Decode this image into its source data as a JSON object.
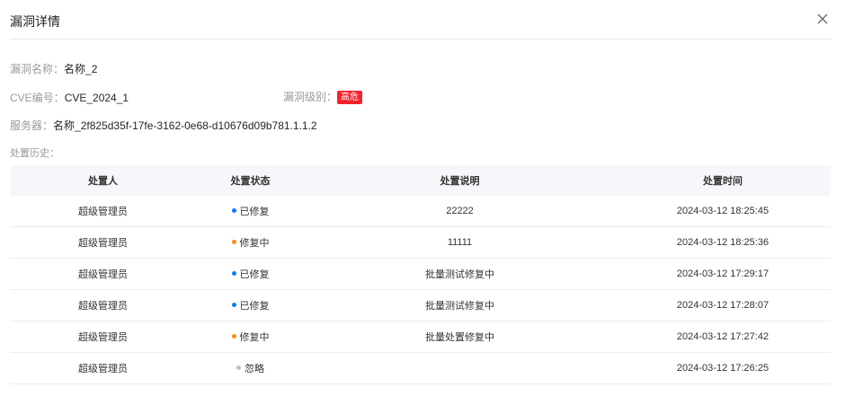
{
  "dialog": {
    "title": "漏洞详情",
    "close_icon": "close-icon"
  },
  "info": {
    "name_label": "漏洞名称：",
    "name_value": "名称_2",
    "cve_label": "CVE编号：",
    "cve_value": "CVE_2024_1",
    "level_label": "漏洞级别：",
    "level_value": "高危",
    "level_color": "#f5222d",
    "server_label": "服务器：",
    "server_value": "名称_2f825d35f-17fe-3162-0e68-d10676d09b781.1.1.2"
  },
  "history": {
    "label": "处置历史：",
    "columns": [
      "处置人",
      "处置状态",
      "处置说明",
      "处置时间"
    ],
    "rows": [
      {
        "person": "超级管理员",
        "status": "已修复",
        "status_color": "#1677ff",
        "note": "22222",
        "time": "2024-03-12 18:25:45"
      },
      {
        "person": "超级管理员",
        "status": "修复中",
        "status_color": "#fa8c16",
        "note": "11111",
        "time": "2024-03-12 18:25:36"
      },
      {
        "person": "超级管理员",
        "status": "已修复",
        "status_color": "#1677ff",
        "note": "批量测试修复中",
        "time": "2024-03-12 17:29:17"
      },
      {
        "person": "超级管理员",
        "status": "已修复",
        "status_color": "#1677ff",
        "note": "批量测试修复中",
        "time": "2024-03-12 17:28:07"
      },
      {
        "person": "超级管理员",
        "status": "修复中",
        "status_color": "#fa8c16",
        "note": "批量处置修复中",
        "time": "2024-03-12 17:27:42"
      },
      {
        "person": "超级管理员",
        "status": "忽略",
        "status_color": "#bfbfbf",
        "note": "",
        "time": "2024-03-12 17:26:25"
      }
    ]
  }
}
